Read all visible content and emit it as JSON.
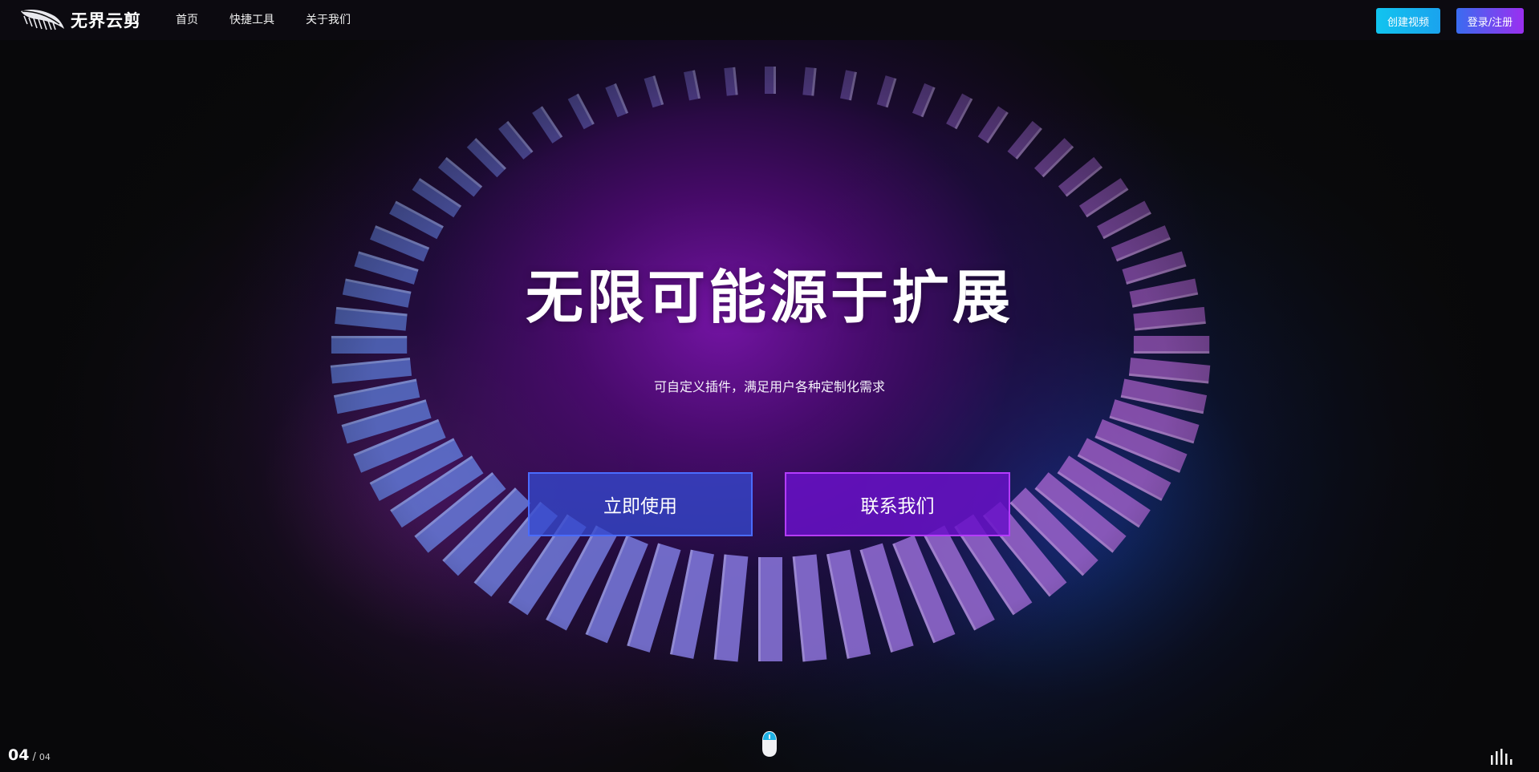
{
  "brand": {
    "name": "无界云剪"
  },
  "nav": {
    "items": [
      {
        "label": "首页"
      },
      {
        "label": "快捷工具"
      },
      {
        "label": "关于我们"
      }
    ]
  },
  "header_actions": {
    "create_label": "创建视频",
    "login_label": "登录/注册"
  },
  "hero": {
    "title": "无限可能源于扩展",
    "subtitle": "可自定义插件，满足用户各种定制化需求",
    "primary_cta": "立即使用",
    "secondary_cta": "联系我们"
  },
  "pager": {
    "current": "04",
    "separator": "/",
    "total": "04"
  },
  "icons": {
    "logo": "feather-logo-icon",
    "scroll": "mouse-scroll-icon",
    "audio": "audio-bars-icon"
  },
  "colors": {
    "create_button": "#11c4ef",
    "login_gradient_start": "#3a6cf0",
    "login_gradient_end": "#9b2ff0",
    "primary_cta_border": "#4a6cff",
    "secondary_cta_border": "#b53cff",
    "background": "#0b0b0c"
  }
}
